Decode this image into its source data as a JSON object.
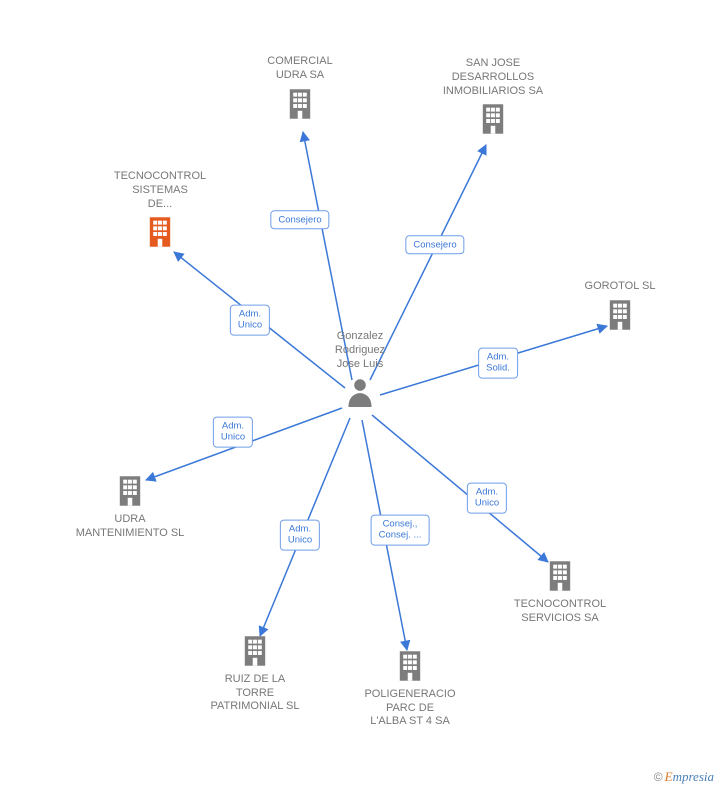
{
  "center": {
    "label": "Gonzalez\nRodriguez\nJose Luis"
  },
  "nodes": {
    "comercial_udra": {
      "label": "COMERCIAL\nUDRA SA",
      "highlight": false
    },
    "san_jose": {
      "label": "SAN JOSE\nDESARROLLOS\nINMOBILIARIOS SA",
      "highlight": false
    },
    "gorotol": {
      "label": "GOROTOL SL",
      "highlight": false
    },
    "tecno_serv": {
      "label": "TECNOCONTROL\nSERVICIOS SA",
      "highlight": false
    },
    "poligeneracio": {
      "label": "POLIGENERACIO\nPARC DE\nL'ALBA ST 4 SA",
      "highlight": false
    },
    "ruiz": {
      "label": "RUIZ DE LA\nTORRE\nPATRIMONIAL SL",
      "highlight": false
    },
    "udra_mant": {
      "label": "UDRA\nMANTENIMIENTO SL",
      "highlight": false
    },
    "tecno_sist": {
      "label": "TECNOCONTROL\nSISTEMAS\nDE...",
      "highlight": true
    }
  },
  "relations": {
    "comercial_udra": "Consejero",
    "san_jose": "Consejero",
    "gorotol": "Adm.\nSolid.",
    "tecno_serv": "Adm.\nUnico",
    "poligeneracio": "Consej.,\nConsej. ...",
    "ruiz": "Adm.\nUnico",
    "udra_mant": "Adm.\nUnico",
    "tecno_sist": "Adm.\nUnico"
  },
  "credit": {
    "copyright": "©",
    "first": "E",
    "rest": "mpresia"
  },
  "colors": {
    "line": "#3b78d8",
    "building": "#7d7d7d",
    "building_highlight": "#e45a1f",
    "person": "#7d7d7d"
  }
}
